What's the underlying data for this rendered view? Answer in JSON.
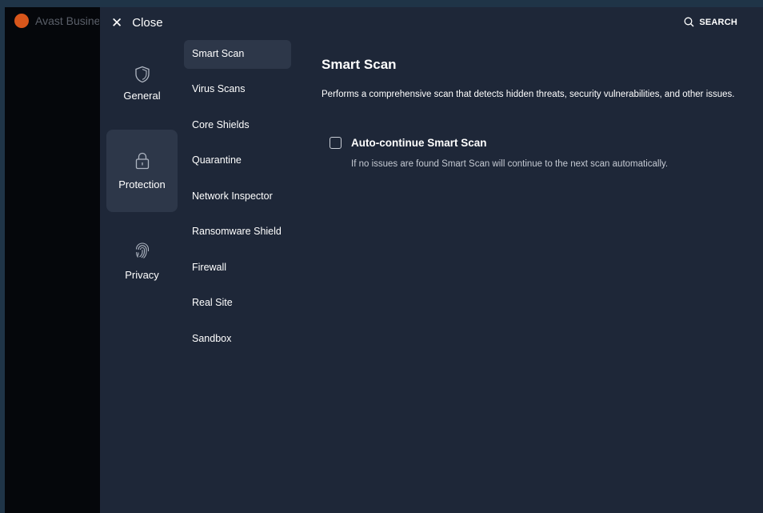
{
  "window": {
    "app_title": "Avast Business"
  },
  "header": {
    "close_label": "Close",
    "search_label": "SEARCH"
  },
  "categories": [
    {
      "label": "General",
      "icon": "shield-icon",
      "active": false
    },
    {
      "label": "Protection",
      "icon": "lock-icon",
      "active": true
    },
    {
      "label": "Privacy",
      "icon": "fingerprint-icon",
      "active": false
    }
  ],
  "subnav": [
    {
      "label": "Smart Scan",
      "active": true
    },
    {
      "label": "Virus Scans"
    },
    {
      "label": "Core Shields"
    },
    {
      "label": "Quarantine"
    },
    {
      "label": "Network Inspector"
    },
    {
      "label": "Ransomware Shield"
    },
    {
      "label": "Firewall"
    },
    {
      "label": "Real Site"
    },
    {
      "label": "Sandbox"
    }
  ],
  "content": {
    "title": "Smart Scan",
    "description": "Performs a comprehensive scan that detects hidden threats, security vulnerabilities, and other issues.",
    "option": {
      "label": "Auto-continue Smart Scan",
      "checked": false,
      "description": "If no issues are found Smart Scan will continue to the next scan automatically."
    }
  },
  "colors": {
    "background": "#1e2738",
    "panel_active": "#2d3749",
    "left_strip": "#05070b",
    "outer_border": "#1f3447",
    "logo": "#d8561b"
  }
}
